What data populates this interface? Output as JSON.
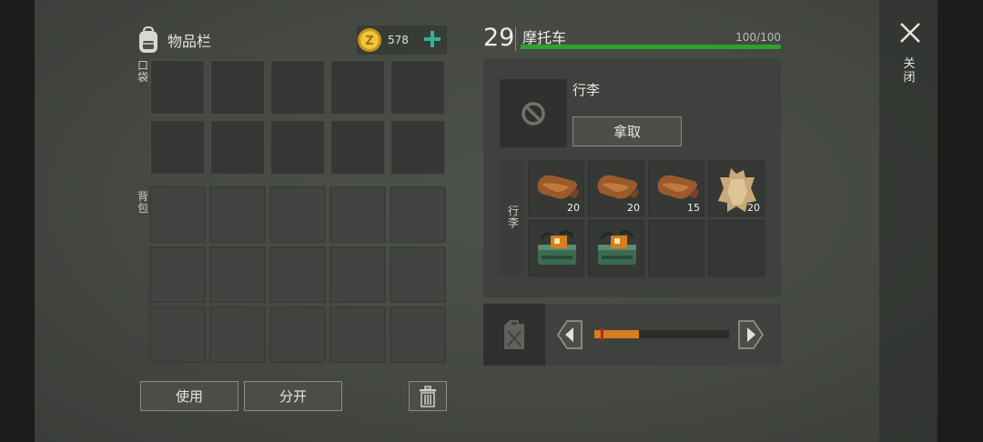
{
  "inventory": {
    "title": "物品栏",
    "gold": "578",
    "pocket_label": "口袋",
    "backpack_label": "背包",
    "pocket_slots": 10,
    "backpack_slots": 15,
    "use_label": "使用",
    "split_label": "分开"
  },
  "vehicle": {
    "level": "29",
    "name": "摩托车",
    "hp_text": "100/100",
    "hp_fraction": 1.0,
    "trunk_title": "行李",
    "take_label": "拿取",
    "trunk_side_label": "行李",
    "fuel_fraction": 0.33
  },
  "trunk_items": [
    {
      "icon": "leather-scroll-icon",
      "qty": "20"
    },
    {
      "icon": "leather-scroll-icon",
      "qty": "20"
    },
    {
      "icon": "leather-scroll-icon",
      "qty": "15"
    },
    {
      "icon": "animal-hide-icon",
      "qty": "20"
    },
    {
      "icon": "green-explosive-case-icon",
      "qty": ""
    },
    {
      "icon": "green-explosive-case-icon",
      "qty": ""
    },
    {
      "icon": "",
      "qty": ""
    },
    {
      "icon": "",
      "qty": ""
    }
  ],
  "close_label": "关闭",
  "colors": {
    "hp_bar": "#2fa22b",
    "fuel_bar": "#d67d1e",
    "fuel_marker": "#c0241c",
    "gold_add": "#2fb39a"
  }
}
